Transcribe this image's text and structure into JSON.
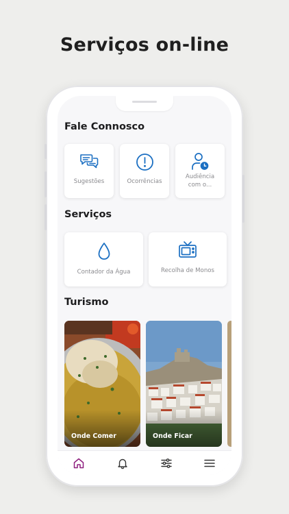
{
  "headline": "Serviços on-line",
  "sections": {
    "contact": {
      "title": "Fale Connosco",
      "cards": [
        {
          "label": "Sugestões",
          "icon": "chat-bubbles-icon"
        },
        {
          "label": "Ocorrências",
          "icon": "alert-circle-icon"
        },
        {
          "label_line1": "Audiência",
          "label_line2": "com o...",
          "icon": "user-clock-icon"
        }
      ]
    },
    "services": {
      "title": "Serviços",
      "cards": [
        {
          "label": "Contador da Água",
          "icon": "water-drop-icon"
        },
        {
          "label": "Recolha de Monos",
          "icon": "tv-icon"
        }
      ]
    },
    "tourism": {
      "title": "Turismo",
      "cards": [
        {
          "label": "Onde Comer",
          "image": "soup-dish-photo"
        },
        {
          "label": "Onde Ficar",
          "image": "coastal-village-photo"
        }
      ]
    }
  },
  "tabbar": {
    "items": [
      {
        "icon": "home-icon",
        "active": true
      },
      {
        "icon": "bell-icon",
        "active": false
      },
      {
        "icon": "sliders-icon",
        "active": false
      },
      {
        "icon": "menu-icon",
        "active": false
      }
    ]
  },
  "colors": {
    "accent_blue": "#1b6fc2",
    "active_tab": "#8e1f7e",
    "inactive_tab": "#333333",
    "background": "#eeeeec"
  }
}
